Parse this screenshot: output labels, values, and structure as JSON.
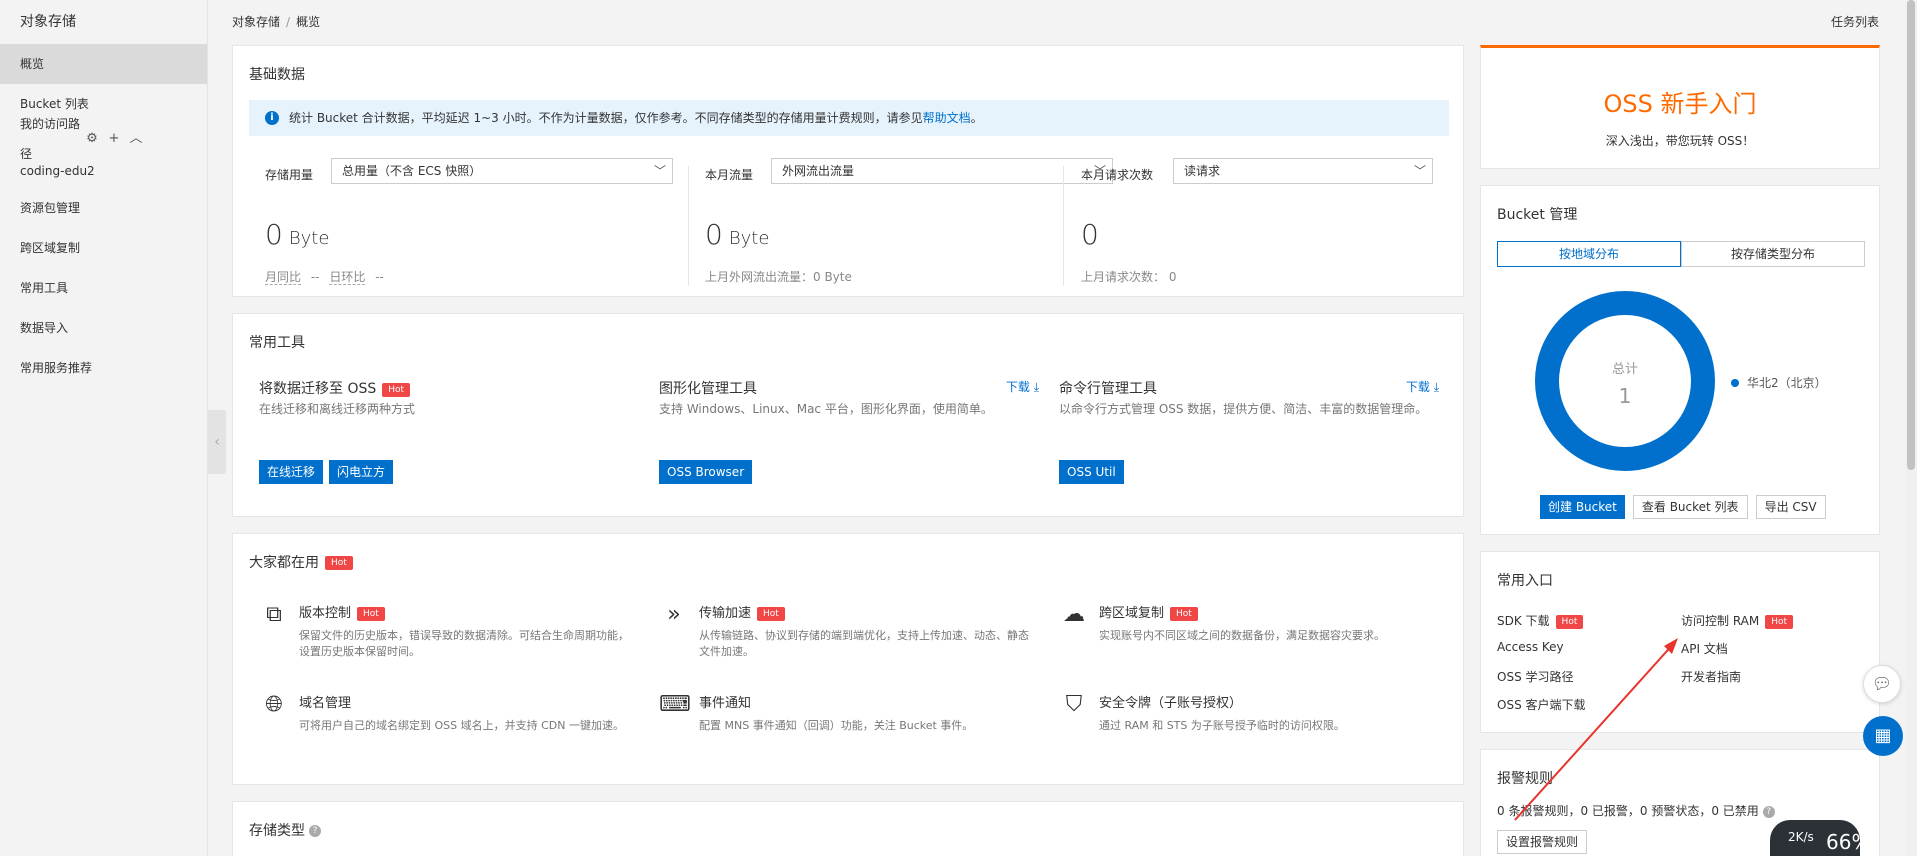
{
  "sidebar": {
    "title": "对象存储",
    "items": [
      "概览",
      "Bucket 列表"
    ],
    "path_label": "我的访问路径",
    "path_items": [
      "coding-edu2"
    ],
    "more_items": [
      "资源包管理",
      "跨区域复制",
      "常用工具",
      "数据导入",
      "常用服务推荐"
    ]
  },
  "topbar": {
    "crumb1": "对象存储",
    "sep": "/",
    "crumb2": "概览",
    "tasks": "任务列表"
  },
  "basic": {
    "title": "基础数据",
    "notice_prefix": "统计 Bucket 合计数据，平均延迟 1~3 小时。不作为计量数据，仅作参考。不同存储类型的存储用量计费规则，请参见",
    "notice_link": "帮助文档",
    "notice_suffix": "。",
    "stats": [
      {
        "label": "存储用量",
        "select": "总用量（不含 ECS 快照）",
        "value": "0",
        "unit": "Byte",
        "sub_a": "月同比",
        "sub_b": "--",
        "sub_c": "日环比",
        "sub_d": "--"
      },
      {
        "label": "本月流量",
        "select": "外网流出流量",
        "value": "0",
        "unit": "Byte",
        "sub": "上月外网流出流量：0 Byte"
      },
      {
        "label": "本月请求次数",
        "select": "读请求",
        "value": "0",
        "unit": "",
        "sub": "上月请求次数： 0"
      }
    ]
  },
  "tools": {
    "title": "常用工具",
    "hot": "Hot",
    "download": "下载",
    "items": [
      {
        "name": "将数据迁移至 OSS",
        "desc": "在线迁移和离线迁移两种方式",
        "buttons": [
          "在线迁移",
          "闪电立方"
        ]
      },
      {
        "name": "图形化管理工具",
        "desc": "支持 Windows、Linux、Mac 平台，图形化界面，使用简单。",
        "buttons": [
          "OSS Browser"
        ]
      },
      {
        "name": "命令行管理工具",
        "desc": "以命令行方式管理 OSS 数据，提供方便、简洁、丰富的数据管理命。",
        "buttons": [
          "OSS Util"
        ]
      }
    ]
  },
  "popular": {
    "title": "大家都在用",
    "hot": "Hot",
    "items": [
      {
        "name": "版本控制",
        "desc": "保留文件的历史版本，错误导致的数据清除。可结合生命周期功能，设置历史版本保留时间。"
      },
      {
        "name": "传输加速",
        "desc": "从传输链路、协议到存储的端到端优化，支持上传加速、动态、静态文件加速。"
      },
      {
        "name": "跨区域复制",
        "desc": "实现账号内不同区域之间的数据备份，满足数据容灾要求。"
      },
      {
        "name": "域名管理",
        "desc": "可将用户自己的域名绑定到 OSS 域名上，并支持 CDN 一键加速。"
      },
      {
        "name": "事件通知",
        "desc": "配置 MNS 事件通知（回调）功能，关注 Bucket 事件。"
      },
      {
        "name": "安全令牌（子账号授权）",
        "desc": "通过 RAM 和 STS 为子账号授予临时的访问权限。"
      }
    ]
  },
  "storage": {
    "title": "存储类型",
    "help": "?"
  },
  "newbie": {
    "title": "OSS 新手入门",
    "sub": "深入浅出，带您玩转 OSS！"
  },
  "bucket": {
    "title": "Bucket 管理",
    "tab_region": "按地域分布",
    "tab_type": "按存储类型分布",
    "total_label": "总计",
    "total_value": "1",
    "legend": "华北2（北京）",
    "btn_create": "创建 Bucket",
    "btn_list": "查看 Bucket 列表",
    "btn_csv": "导出 CSV"
  },
  "entry": {
    "title": "常用入口",
    "hot": "Hot",
    "sdk": "SDK 下载",
    "ram": "访问控制 RAM",
    "ak": "Access Key",
    "api": "API 文档",
    "learn": "OSS 学习路径",
    "dev": "开发者指南",
    "client": "OSS 客户端下载"
  },
  "alarm": {
    "title": "报警规则",
    "text": "0 条报警规则，0 已报警，0 预警状态，0 已禁用",
    "help": "?",
    "btn": "设置报警规则"
  },
  "speed": {
    "rate": "2K/s",
    "percent": "66%"
  },
  "colors": {
    "accent": "#0070cc",
    "orange": "#ff6a00",
    "hot": "#f04646",
    "arrow": "#e8342c"
  }
}
